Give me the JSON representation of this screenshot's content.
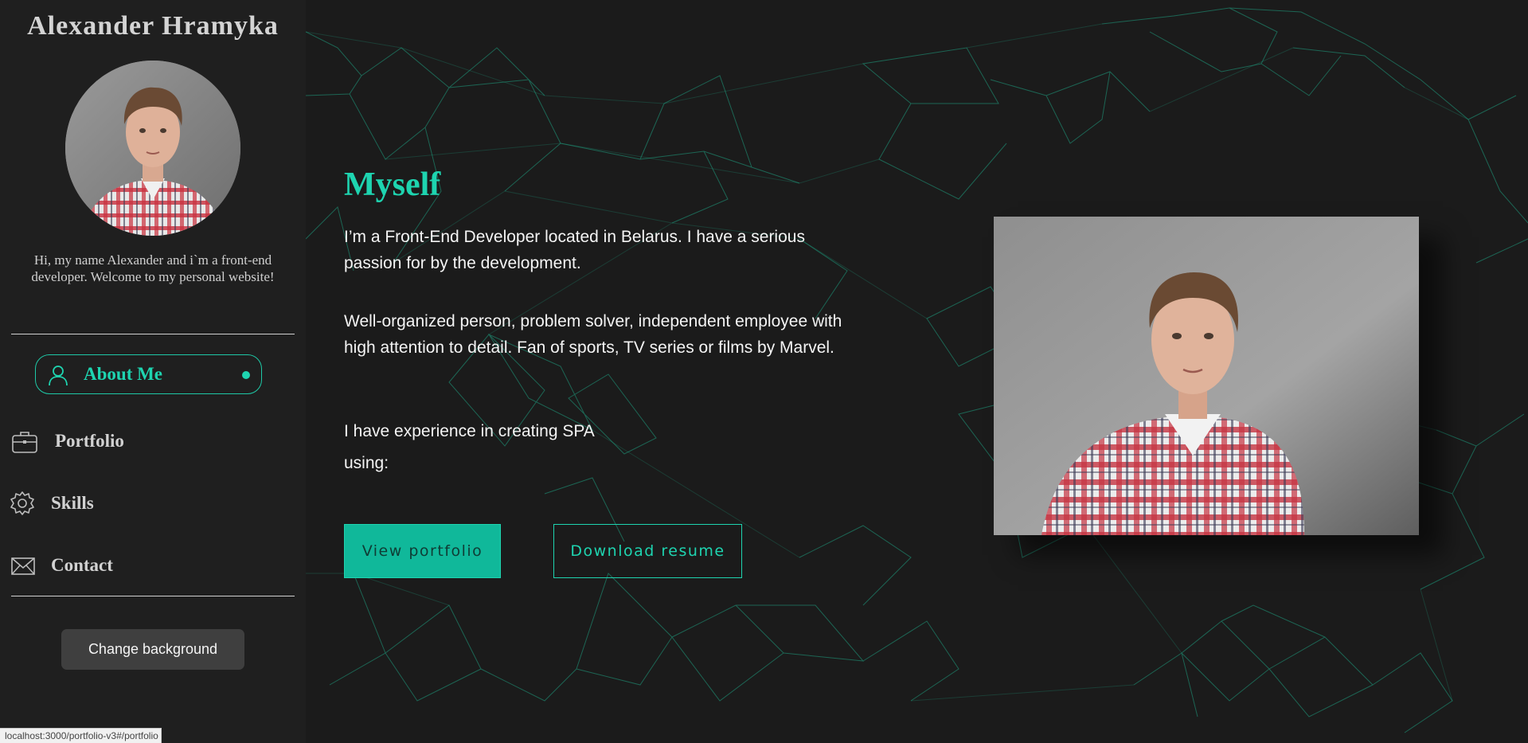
{
  "sidebar": {
    "title": "Alexander Hramyka",
    "intro": "Hi, my name Alexander and i`m a front-end developer. Welcome to my personal website!",
    "nav": {
      "about": "About Me",
      "portfolio": "Portfolio",
      "skills": "Skills",
      "contact": "Contact"
    },
    "change_background": "Change background"
  },
  "main": {
    "heading": "Myself",
    "paragraph_1": "I’m a Front-End Developer located in Belarus. I have a serious passion for by the development.",
    "paragraph_2": "Well-organized person, problem solver, independent employee with high attention to detail. Fan of sports, TV series or films by Marvel.",
    "paragraph_3_line_1": "I have experience in creating SPA",
    "paragraph_3_line_2": "using:",
    "view_portfolio": "View portfolio",
    "download_resume": "Download resume"
  },
  "status_bar": {
    "url": "localhost:3000/portfolio-v3#/portfolio"
  },
  "colors": {
    "accent": "#1ed4b0",
    "accent_button_bg": "#10b89a",
    "sidebar_bg": "#1f1f1f",
    "page_bg": "#1b1b1b",
    "change_bg_button": "#3f3f3f"
  },
  "icons": {
    "about": "person-icon",
    "portfolio": "briefcase-icon",
    "skills": "gear-icon",
    "contact": "envelope-icon"
  }
}
